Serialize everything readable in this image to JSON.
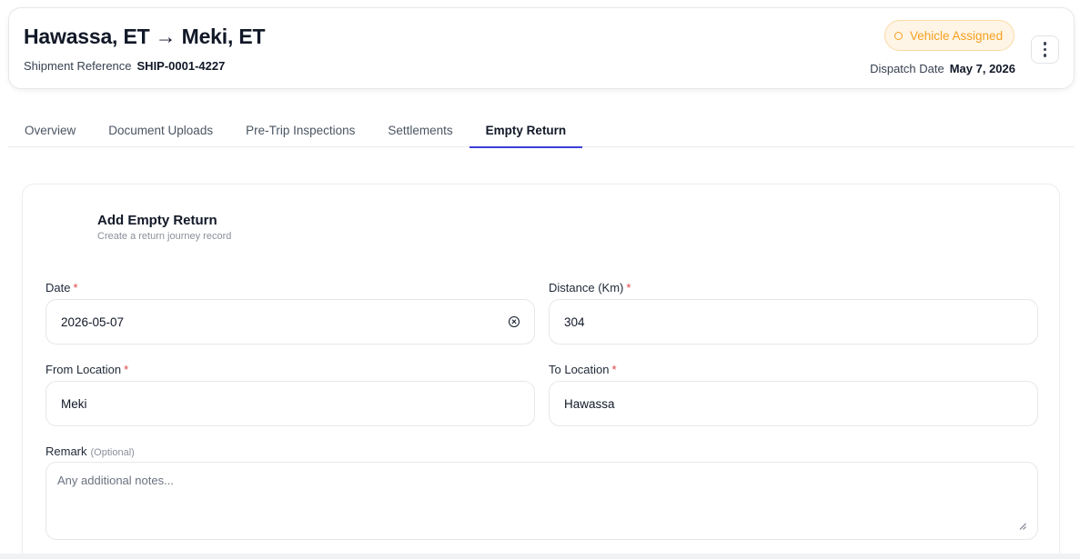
{
  "header": {
    "route": "Hawassa, ET → Meki, ET",
    "reference_label": "Shipment Reference",
    "reference_value": "SHIP-0001-4227",
    "status": "Vehicle Assigned",
    "dispatch_label": "Dispatch Date",
    "dispatch_value": "May 7, 2026",
    "more_icon": "vertical-dots-icon"
  },
  "tabs": [
    {
      "label": "Overview",
      "active": false
    },
    {
      "label": "Document Uploads",
      "active": false
    },
    {
      "label": "Pre-Trip Inspections",
      "active": false
    },
    {
      "label": "Settlements",
      "active": false
    },
    {
      "label": "Empty Return",
      "active": true
    }
  ],
  "form": {
    "title": "Add Empty Return",
    "subtitle": "Create a return journey record",
    "date": {
      "label": "Date",
      "required": "*",
      "value": "2026-05-07"
    },
    "distance": {
      "label": "Distance (Km)",
      "required": "*",
      "value": "304"
    },
    "from_location": {
      "label": "From Location",
      "required": "*",
      "value": "Meki"
    },
    "to_location": {
      "label": "To Location",
      "required": "*",
      "value": "Hawassa"
    },
    "remark": {
      "label": "Remark",
      "optional": "(Optional)",
      "placeholder": "Any additional notes..."
    }
  },
  "colors": {
    "accent": "#3b3fd8",
    "status_text": "#f5a020",
    "status_bg": "#fff5e6",
    "required": "#e04444"
  }
}
